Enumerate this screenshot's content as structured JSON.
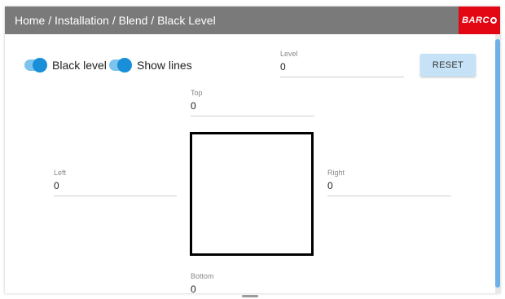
{
  "header": {
    "breadcrumb": "Home / Installation / Blend / Black Level",
    "logo_text": "BARC",
    "logo_color": "#e30613",
    "background_color": "#7a7a7a"
  },
  "toggles": {
    "black_level": {
      "label": "Black level",
      "state": "on"
    },
    "show_lines": {
      "label": "Show lines",
      "state": "on"
    }
  },
  "fields": {
    "level": {
      "label": "Level",
      "value": "0"
    },
    "top": {
      "label": "Top",
      "value": "0"
    },
    "left": {
      "label": "Left",
      "value": "0"
    },
    "right": {
      "label": "Right",
      "value": "0"
    },
    "bottom": {
      "label": "Bottom",
      "value": "0"
    }
  },
  "reset_button": {
    "label": "RESET"
  },
  "accent_color": "#1a8fd9"
}
